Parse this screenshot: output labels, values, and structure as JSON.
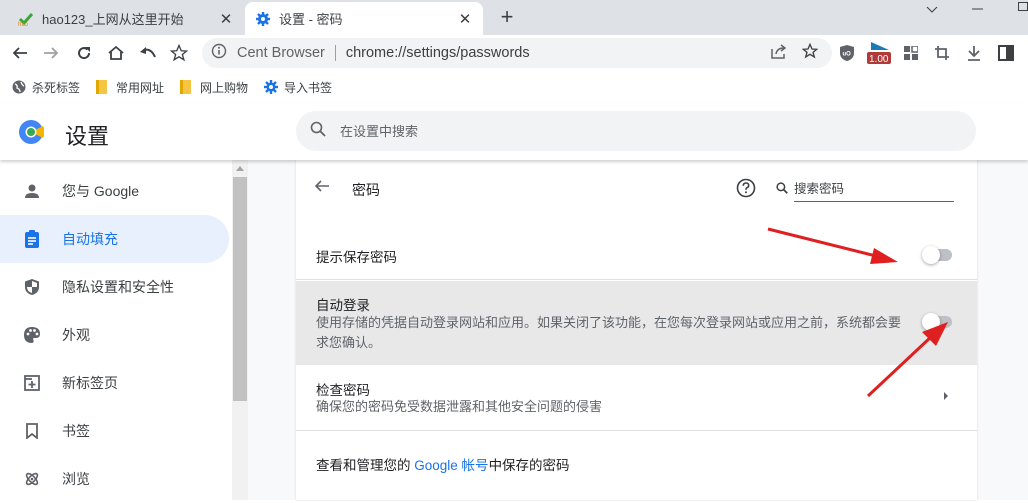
{
  "browser": {
    "tabs": [
      {
        "title": "hao123_上网从这里开始",
        "icon": "hao123-favicon",
        "active": false
      },
      {
        "title": "设置 - 密码",
        "icon": "gear-favicon",
        "active": true
      }
    ],
    "new_tab_label": "+",
    "window_controls": {
      "tab_search": "⌄",
      "minimize": "—",
      "maximize": "□"
    },
    "omnibox": {
      "brand": "Cent Browser",
      "url": "chrome://settings/passwords"
    },
    "extension_badge": "1.00",
    "bookmarks": [
      {
        "label": "杀死标签",
        "icon": "globe-icon"
      },
      {
        "label": "常用网址",
        "icon": "folder-icon"
      },
      {
        "label": "网上购物",
        "icon": "folder-icon"
      },
      {
        "label": "导入书签",
        "icon": "gear-icon"
      }
    ]
  },
  "settings": {
    "title": "设置",
    "search_placeholder": "在设置中搜索",
    "sidebar": [
      {
        "label": "您与 Google",
        "icon": "person-icon",
        "selected": false
      },
      {
        "label": "自动填充",
        "icon": "clipboard-icon",
        "selected": true
      },
      {
        "label": "隐私设置和安全性",
        "icon": "shield-icon",
        "selected": false
      },
      {
        "label": "外观",
        "icon": "palette-icon",
        "selected": false
      },
      {
        "label": "新标签页",
        "icon": "new-tab-icon",
        "selected": false
      },
      {
        "label": "书签",
        "icon": "bookmark-icon",
        "selected": false
      },
      {
        "label": "浏览",
        "icon": "atom-icon",
        "selected": false
      }
    ],
    "passwords": {
      "page_title": "密码",
      "search_placeholder": "搜索密码",
      "rows": [
        {
          "label": "提示保存密码",
          "toggle": false
        },
        {
          "label": "自动登录",
          "description": "使用存储的凭据自动登录网站和应用。如果关闭了该功能，在您每次登录网站或应用之前，系统都会要求您确认。",
          "toggle": false
        },
        {
          "label": "检查密码",
          "description": "确保您的密码免受数据泄露和其他安全问题的侵害"
        }
      ],
      "manage": {
        "prefix": "查看和管理您的 ",
        "link": "Google 帐号",
        "suffix": "中保存的密码"
      }
    }
  },
  "colors": {
    "accent": "#1a73e8",
    "selected_bg": "#e8f0fe",
    "annotation_arrow": "#e02020"
  }
}
